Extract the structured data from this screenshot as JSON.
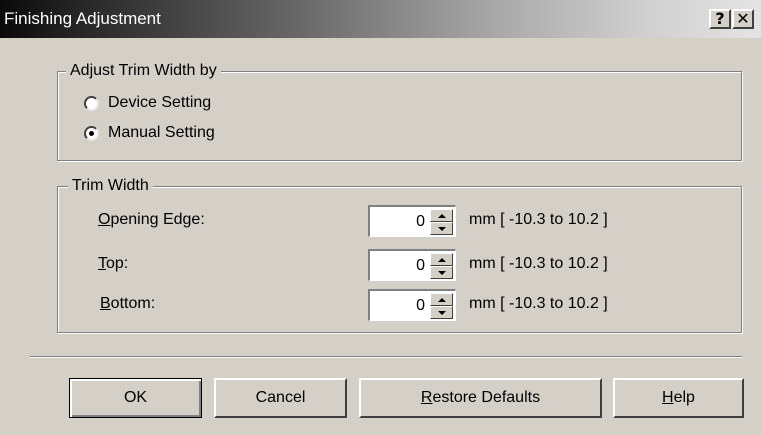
{
  "window": {
    "title": "Finishing Adjustment"
  },
  "caption_buttons": {
    "help": "?",
    "close": "✕"
  },
  "adjust_group": {
    "legend": "Adjust Trim Width by",
    "options": [
      {
        "label": "Device Setting",
        "checked": false
      },
      {
        "label": "Manual Setting",
        "checked": true
      }
    ]
  },
  "trim_group": {
    "legend": "Trim Width",
    "fields": [
      {
        "accel": "O",
        "rest": "pening Edge:",
        "value": "0",
        "range": "mm [ -10.3  to  10.2 ]"
      },
      {
        "accel": "T",
        "rest": "op:",
        "value": "0",
        "range": "mm [ -10.3  to  10.2 ]"
      },
      {
        "accel": "B",
        "rest": "ottom:",
        "value": "0",
        "range": "mm [ -10.3  to  10.2 ]"
      }
    ]
  },
  "buttons": {
    "ok": "OK",
    "cancel": "Cancel",
    "restore_accel": "R",
    "restore_rest": "estore Defaults",
    "help_accel": "H",
    "help_rest": "elp"
  }
}
